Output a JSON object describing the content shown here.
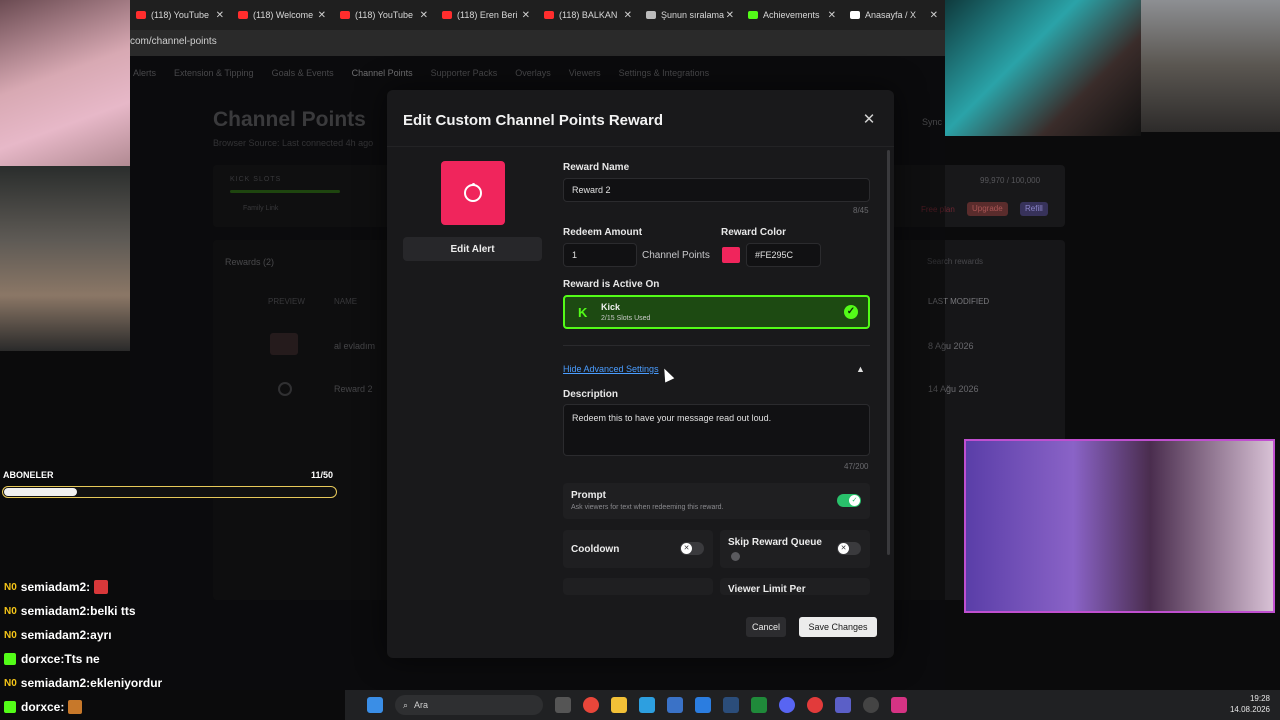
{
  "browser": {
    "tabs": [
      {
        "label": "(118) YouTube",
        "color": "#ff2d2d"
      },
      {
        "label": "(118) Welcome",
        "color": "#ff2d2d"
      },
      {
        "label": "(118) YouTube",
        "color": "#ff2d2d"
      },
      {
        "label": "(118) Eren Beri",
        "color": "#ff2d2d"
      },
      {
        "label": "(118) BALKAN",
        "color": "#ff2d2d"
      },
      {
        "label": "Şunun sıralama",
        "color": "#bbbbbb"
      },
      {
        "label": "Achievements",
        "color": "#53fc18"
      },
      {
        "label": "Anasayfa / X",
        "color": "#ffffff"
      }
    ],
    "address": "com/channel-points"
  },
  "page": {
    "subnav": [
      "Alerts",
      "Extension & Tipping",
      "Goals & Events",
      "Channel Points",
      "Supporter Packs",
      "Overlays",
      "Viewers",
      "Settings & Integrations"
    ],
    "title": "Channel Points",
    "subtitle": "Browser Source: Last connected 4h ago",
    "kick_slots_label": "KICK SLOTS",
    "family_link": "Family Link",
    "points": "99,970 / 100,000",
    "free_plan": "Free plan",
    "upgrade": "Upgrade",
    "refill": "Refill",
    "rewards_header": "Rewards (2)",
    "search_placeholder": "Search rewards",
    "col_preview": "PREVIEW",
    "col_name": "NAME",
    "col_modified": "LAST MODIFIED",
    "rows": [
      {
        "name": "al evladım",
        "date": "8 Ağu 2026"
      },
      {
        "name": "Reward 2",
        "date": "14 Ağu 2026"
      }
    ],
    "sync": "Sync"
  },
  "modal": {
    "title": "Edit Custom Channel Points Reward",
    "edit_alert": "Edit Alert",
    "reward_name_label": "Reward Name",
    "reward_name": "Reward 2",
    "reward_name_counter": "8/45",
    "redeem_amount_label": "Redeem Amount",
    "redeem_amount": "1",
    "redeem_suffix": "Channel Points",
    "reward_color_label": "Reward Color",
    "reward_color": "#FE295C",
    "active_on_label": "Reward is Active On",
    "platform": "Kick",
    "platform_initial": "K",
    "slots_used": "2/15 Slots Used",
    "advanced_toggle": "Hide Advanced Settings",
    "description_label": "Description",
    "description": "Redeem this to have your message read out loud.",
    "description_counter": "47/200",
    "prompt_label": "Prompt",
    "prompt_sub": "Ask viewers for text when redeeming this reward.",
    "prompt_on": true,
    "cooldown_label": "Cooldown",
    "skip_queue_label": "Skip Reward Queue",
    "viewer_limit_label": "Viewer Limit Per",
    "cancel": "Cancel",
    "save": "Save Changes"
  },
  "overlay": {
    "subs_label": "ABONELER",
    "subs_count": "11/50",
    "subs_progress": 0.22,
    "chat": [
      {
        "user": "semiadam2",
        "sep": " : ",
        "msg": "",
        "badge": "N0",
        "emote": true
      },
      {
        "user": "semiadam2",
        "sep": " : ",
        "msg": "belki tts",
        "badge": "N0"
      },
      {
        "user": "semiadam2",
        "sep": " : ",
        "msg": "ayrı",
        "badge": "N0"
      },
      {
        "user": "dorxce",
        "sep": " : ",
        "msg": "Tts ne",
        "badge": ""
      },
      {
        "user": "semiadam2",
        "sep": " : ",
        "msg": "ekleniyordur",
        "badge": "N0"
      },
      {
        "user": "dorxce",
        "sep": " : ",
        "msg": "",
        "badge": "",
        "emote": true
      }
    ]
  },
  "taskbar": {
    "search": "Ara",
    "time": "19:28",
    "date": "14.08.2026"
  }
}
